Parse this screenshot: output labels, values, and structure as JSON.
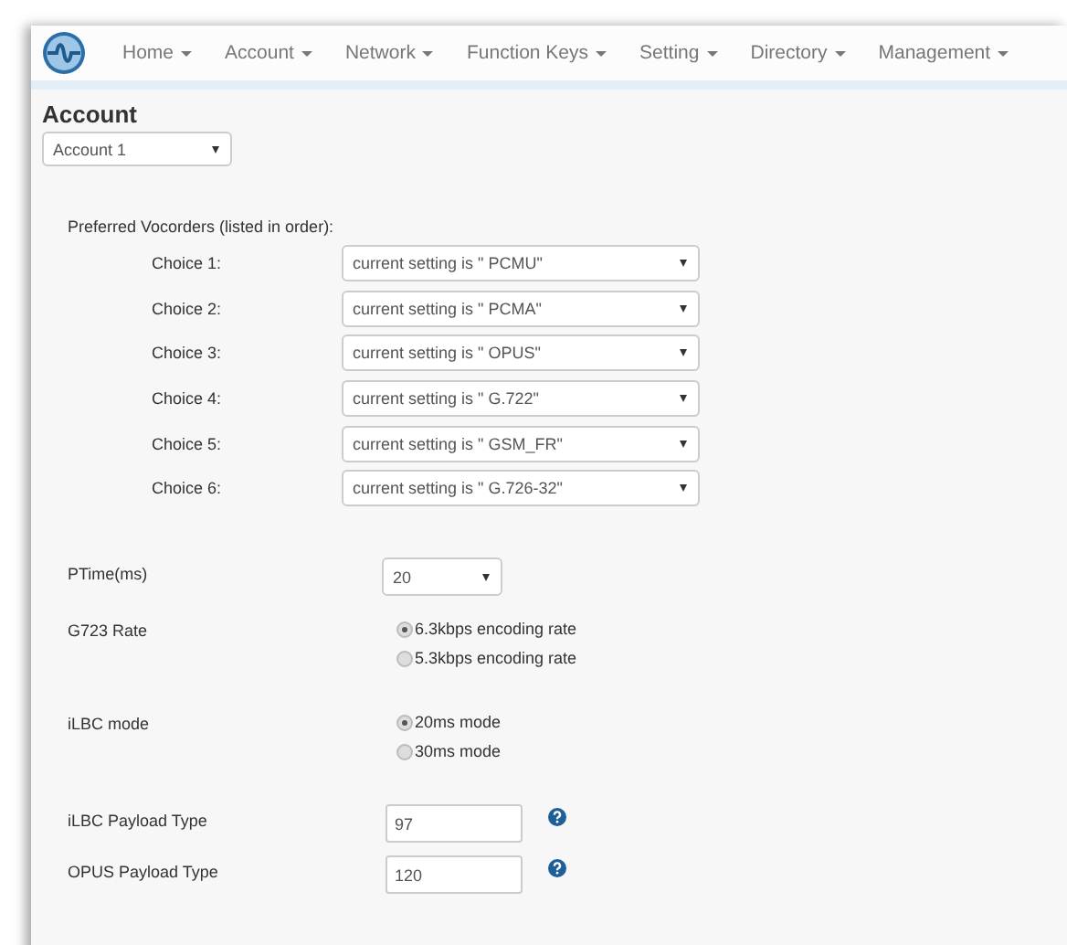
{
  "nav": {
    "items": [
      {
        "label": "Home"
      },
      {
        "label": "Account"
      },
      {
        "label": "Network"
      },
      {
        "label": "Function Keys"
      },
      {
        "label": "Setting"
      },
      {
        "label": "Directory"
      },
      {
        "label": "Management"
      }
    ]
  },
  "section": {
    "title": "Account",
    "account_select": "Account 1"
  },
  "vocoders": {
    "label": "Preferred Vocorders (listed in order):",
    "choices": [
      {
        "label": "Choice 1:",
        "value": "current setting is \" PCMU\""
      },
      {
        "label": "Choice 2:",
        "value": "current setting is \" PCMA\""
      },
      {
        "label": "Choice 3:",
        "value": "current setting is \" OPUS\""
      },
      {
        "label": "Choice 4:",
        "value": "current setting is \" G.722\""
      },
      {
        "label": "Choice 5:",
        "value": "current setting is \" GSM_FR\""
      },
      {
        "label": "Choice 6:",
        "value": "current setting is \" G.726-32\""
      }
    ]
  },
  "fields": [
    {
      "kind": "select",
      "label": "PTime(ms)",
      "value": "20"
    },
    {
      "kind": "radio",
      "label": "G723 Rate",
      "options": [
        {
          "label": "6.3kbps encoding rate",
          "selected": true
        },
        {
          "label": "5.3kbps encoding rate",
          "selected": false
        }
      ]
    },
    {
      "kind": "radio",
      "label": "iLBC mode",
      "options": [
        {
          "label": "20ms mode",
          "selected": true
        },
        {
          "label": "30ms mode",
          "selected": false
        }
      ]
    },
    {
      "kind": "input",
      "label": "iLBC Payload Type",
      "value": "97",
      "help": true
    },
    {
      "kind": "input",
      "label": "OPUS Payload Type",
      "value": "120",
      "help": true
    }
  ]
}
